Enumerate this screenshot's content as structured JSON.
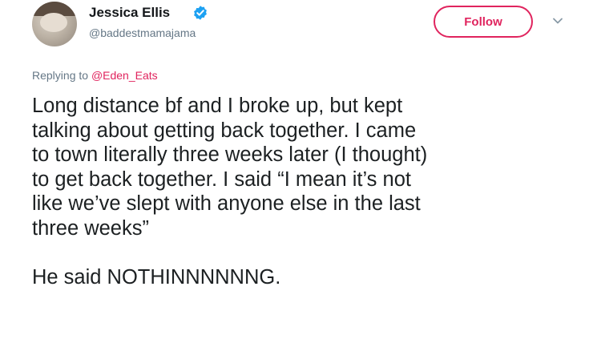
{
  "author": {
    "display_name": "Jessica Ellis",
    "handle": "@baddestmamajama",
    "verified": true
  },
  "actions": {
    "follow_label": "Follow"
  },
  "reply": {
    "prefix": "Replying to ",
    "mention": "@Eden_Eats"
  },
  "tweet": {
    "lines": [
      "Long distance bf and I broke up, but kept",
      "talking about getting back together. I came",
      "to town literally three weeks later (I thought)",
      "to get back together. I said “I mean it’s not",
      "like we’ve slept with anyone else in the last",
      "three weeks”"
    ],
    "second_paragraph": "He said NOTHINNNNNNG."
  },
  "colors": {
    "accent": "#e0245e",
    "verified": "#1da1f2",
    "secondary_text": "#657786",
    "primary_text": "#1c2022"
  },
  "icons": {
    "verified": "verified-badge-icon",
    "menu": "chevron-down-icon"
  }
}
